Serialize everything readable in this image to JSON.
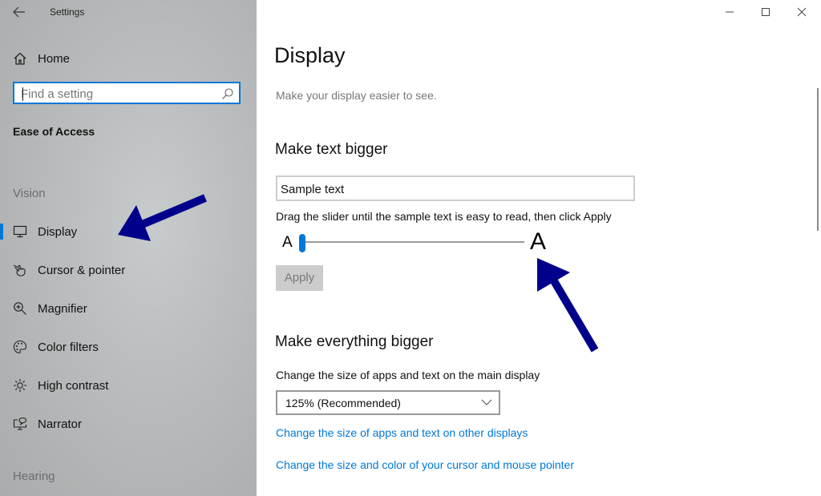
{
  "window": {
    "title": "Settings",
    "controls": {
      "minimize": "minimize-icon",
      "maximize": "maximize-icon",
      "close": "close-icon"
    }
  },
  "sidebar": {
    "back_icon": "back-arrow-icon",
    "home_label": "Home",
    "search": {
      "value": "",
      "placeholder": "Find a setting",
      "icon": "search-icon"
    },
    "section_title": "Ease of Access",
    "groups": [
      {
        "label": "Vision",
        "items": [
          {
            "label": "Display",
            "icon": "monitor-icon",
            "selected": true
          },
          {
            "label": "Cursor & pointer",
            "icon": "pointer-icon",
            "selected": false
          },
          {
            "label": "Magnifier",
            "icon": "magnifier-icon",
            "selected": false
          },
          {
            "label": "Color filters",
            "icon": "palette-icon",
            "selected": false
          },
          {
            "label": "High contrast",
            "icon": "sun-icon",
            "selected": false
          },
          {
            "label": "Narrator",
            "icon": "narrator-icon",
            "selected": false
          }
        ]
      },
      {
        "label": "Hearing",
        "items": []
      }
    ]
  },
  "main": {
    "title": "Display",
    "subtitle": "Make your display easier to see.",
    "text_bigger": {
      "heading": "Make text bigger",
      "sample_text": "Sample text",
      "hint": "Drag the slider until the sample text is easy to read, then click Apply",
      "slider_min_label": "A",
      "slider_max_label": "A",
      "slider_value_fraction": 0.0,
      "apply_label": "Apply",
      "apply_enabled": false
    },
    "everything_bigger": {
      "heading": "Make everything bigger",
      "label": "Change the size of apps and text on the main display",
      "selected_scale": "125% (Recommended)",
      "links": [
        "Change the size of apps and text on other displays",
        "Change the size and color of your cursor and mouse pointer"
      ]
    }
  },
  "annotations": {
    "arrow_color": "#00008b",
    "arrows": [
      "pointing-to-display-nav",
      "pointing-to-text-size-slider"
    ]
  },
  "colors": {
    "accent": "#0078d7",
    "link": "#0078d7",
    "disabled_button": "#cccccc"
  }
}
